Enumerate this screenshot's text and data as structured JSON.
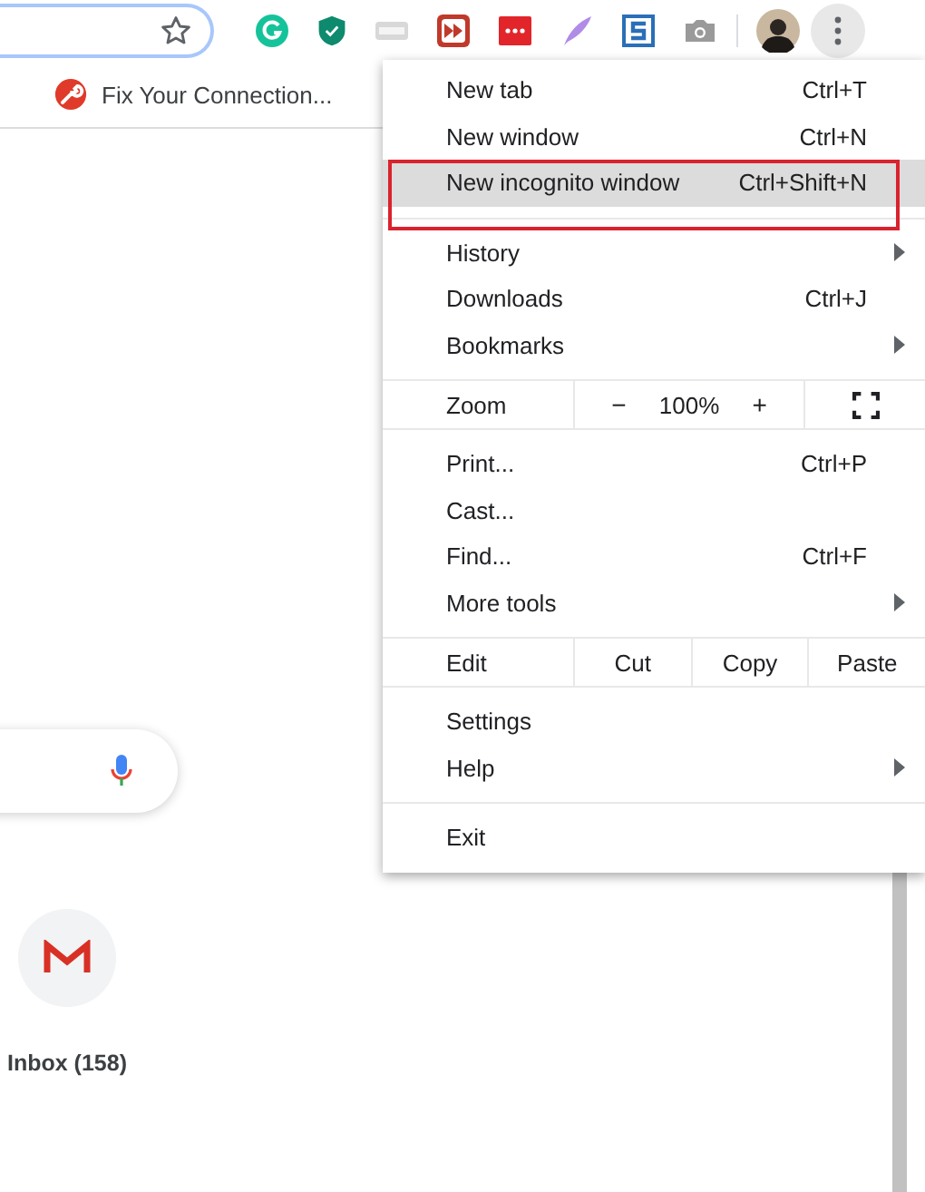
{
  "bookmarks": [
    {
      "label": "Fix Your Connection..."
    }
  ],
  "menu": {
    "sections": [
      [
        {
          "kind": "item",
          "label": "New tab",
          "shortcut": "Ctrl+T",
          "submenu": false,
          "selected": false
        },
        {
          "kind": "item",
          "label": "New window",
          "shortcut": "Ctrl+N",
          "submenu": false,
          "selected": false
        },
        {
          "kind": "item",
          "label": "New incognito window",
          "shortcut": "Ctrl+Shift+N",
          "submenu": false,
          "selected": true
        }
      ],
      [
        {
          "kind": "item",
          "label": "History",
          "submenu": true,
          "selected": false
        },
        {
          "kind": "item",
          "label": "Downloads",
          "shortcut": "Ctrl+J",
          "submenu": false,
          "selected": false
        },
        {
          "kind": "item",
          "label": "Bookmarks",
          "submenu": true,
          "selected": false
        }
      ],
      [
        {
          "kind": "zoom",
          "label": "Zoom",
          "minus": "−",
          "value": "100%",
          "plus": "+"
        }
      ],
      [
        {
          "kind": "item",
          "label": "Print...",
          "shortcut": "Ctrl+P",
          "submenu": false,
          "selected": false
        },
        {
          "kind": "item",
          "label": "Cast...",
          "submenu": false,
          "selected": false
        },
        {
          "kind": "item",
          "label": "Find...",
          "shortcut": "Ctrl+F",
          "submenu": false,
          "selected": false
        },
        {
          "kind": "item",
          "label": "More tools",
          "submenu": true,
          "selected": false
        }
      ],
      [
        {
          "kind": "edit",
          "label": "Edit",
          "actions": [
            "Cut",
            "Copy",
            "Paste"
          ]
        }
      ],
      [
        {
          "kind": "item",
          "label": "Settings",
          "submenu": false,
          "selected": false
        },
        {
          "kind": "item",
          "label": "Help",
          "submenu": true,
          "selected": false
        }
      ],
      [
        {
          "kind": "item",
          "label": "Exit",
          "submenu": false,
          "selected": false
        }
      ]
    ]
  },
  "page": {
    "shortcuts": [
      {
        "label": "Inbox (158)"
      }
    ]
  }
}
